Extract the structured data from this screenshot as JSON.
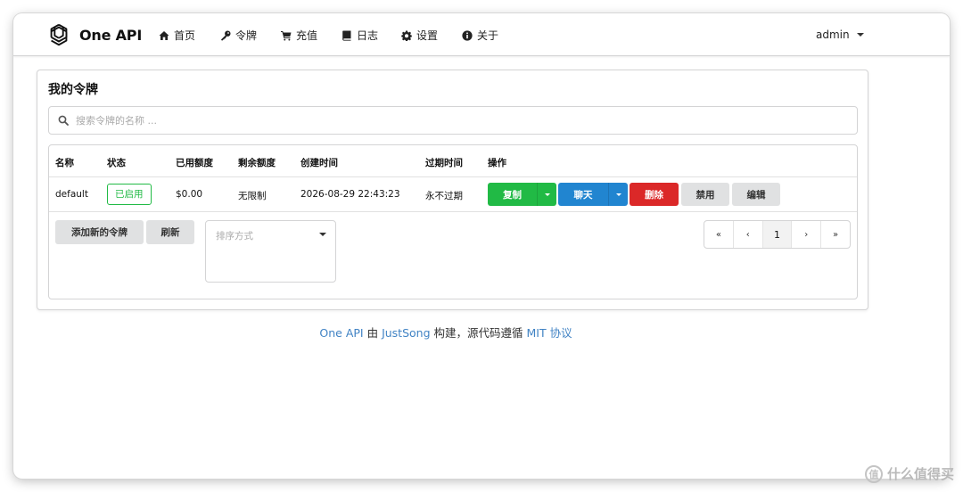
{
  "app": {
    "brand_name": "One API"
  },
  "nav": {
    "items": [
      {
        "label": "首页",
        "icon": "home-icon"
      },
      {
        "label": "令牌",
        "icon": "key-icon"
      },
      {
        "label": "充值",
        "icon": "cart-icon"
      },
      {
        "label": "日志",
        "icon": "book-icon"
      },
      {
        "label": "设置",
        "icon": "gear-icon"
      },
      {
        "label": "关于",
        "icon": "info-icon"
      }
    ],
    "user": "admin"
  },
  "tokens_page": {
    "title": "我的令牌",
    "search_placeholder": "搜索令牌的名称 ...",
    "columns": [
      "名称",
      "状态",
      "已用额度",
      "剩余额度",
      "创建时间",
      "过期时间",
      "操作"
    ],
    "rows": [
      {
        "name": "default",
        "status": "已启用",
        "used_quota": "$0.00",
        "remaining_quota": "无限制",
        "created_time": "2026-08-29 22:43:23",
        "expire_time": "永不过期"
      }
    ],
    "actions": {
      "copy": "复制",
      "chat": "聊天",
      "delete": "删除",
      "disable": "禁用",
      "edit": "编辑"
    },
    "add_button": "添加新的令牌",
    "refresh_button": "刷新",
    "sort_placeholder": "排序方式",
    "pagination": {
      "first": "«",
      "prev": "‹",
      "current": "1",
      "next": "›",
      "last": "»"
    }
  },
  "footer": {
    "link1": "One API",
    "text1": " 由 ",
    "link2": "JustSong",
    "text2": " 构建，源代码遵循 ",
    "link3": "MIT 协议"
  },
  "watermark": {
    "text": "什么值得买",
    "mark": "值"
  },
  "colors": {
    "green": "#21ba45",
    "blue": "#2185d0",
    "red": "#db2828",
    "grey": "#e0e1e2",
    "link": "#4183c4"
  }
}
